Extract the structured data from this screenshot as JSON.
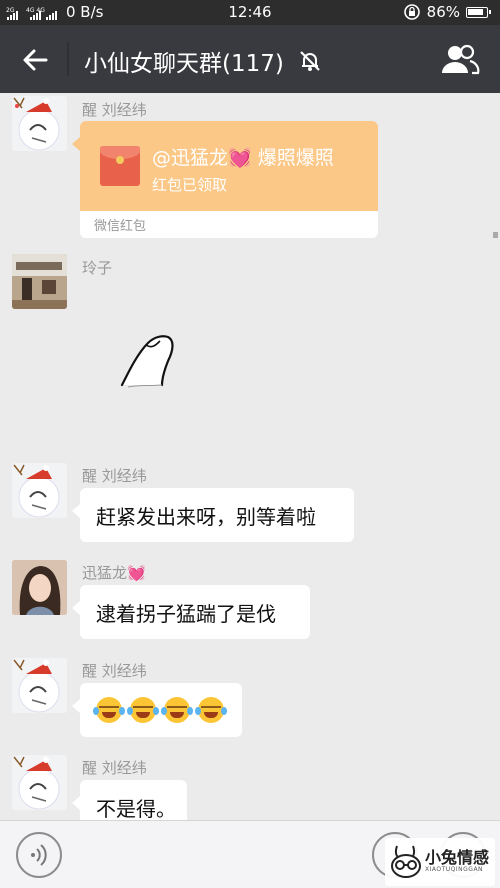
{
  "status_bar": {
    "signal_label": "2G 4G 4G",
    "net_speed": "0 B/s",
    "time": "12:46",
    "battery": "86%"
  },
  "title_bar": {
    "title": "小仙女聊天群(117)"
  },
  "messages": [
    {
      "sender": "醒 刘经纬",
      "type": "red_packet",
      "packet_title": "@迅猛龙💓 爆照爆照",
      "packet_status": "红包已领取",
      "packet_footer": "微信红包"
    },
    {
      "sender": "玲子",
      "type": "sticker"
    },
    {
      "sender": "醒 刘经纬",
      "type": "text",
      "text": "赶紧发出来呀，别等着啦"
    },
    {
      "sender": "迅猛龙💓",
      "type": "text",
      "text": "逮着拐子猛踹了是伐"
    },
    {
      "sender": "醒 刘经纬",
      "type": "emoji",
      "emoji_count": 4,
      "emoji_name": "laughing-tears-emoji"
    },
    {
      "sender": "醒 刘经纬",
      "type": "text",
      "text": "不是得。"
    }
  ],
  "watermark": {
    "text": "小兔情感",
    "sub": "XIAOTUQINGGAN"
  },
  "colors": {
    "titlebar": "#393a3f",
    "statusbar": "#2d2d2d",
    "chat_bg": "#ebebeb",
    "red_packet": "#fbc888"
  }
}
